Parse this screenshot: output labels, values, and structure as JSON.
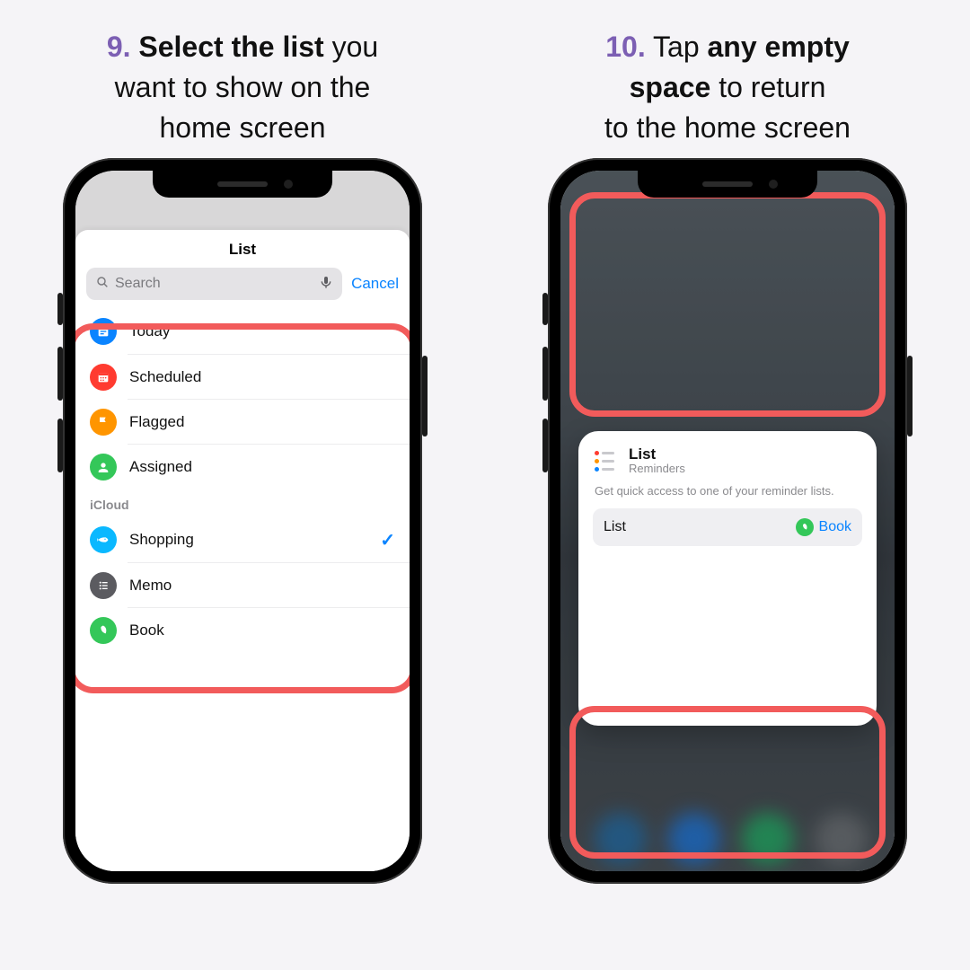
{
  "left": {
    "step": "9.",
    "caption_bold": "Select the list",
    "caption_rest1": "you",
    "caption_line2": "want to show on the",
    "caption_line3": "home screen",
    "sheet_title": "List",
    "search_placeholder": "Search",
    "cancel": "Cancel",
    "smart_lists": [
      {
        "label": "Today",
        "icon": "today"
      },
      {
        "label": "Scheduled",
        "icon": "scheduled"
      },
      {
        "label": "Flagged",
        "icon": "flagged"
      },
      {
        "label": "Assigned",
        "icon": "assigned"
      }
    ],
    "section_header": "iCloud",
    "user_lists": [
      {
        "label": "Shopping",
        "icon": "shopping",
        "selected": true
      },
      {
        "label": "Memo",
        "icon": "memo"
      },
      {
        "label": "Book",
        "icon": "book"
      }
    ]
  },
  "right": {
    "step": "10.",
    "caption_line1a": "Tap",
    "caption_line1_bold": "any empty",
    "caption_line2_bold": "space",
    "caption_line2_rest": "to return",
    "caption_line3": "to the home screen",
    "widget": {
      "title": "List",
      "subtitle": "Reminders",
      "description": "Get quick access to one of your reminder lists.",
      "row_label": "List",
      "row_value": "Book"
    }
  }
}
